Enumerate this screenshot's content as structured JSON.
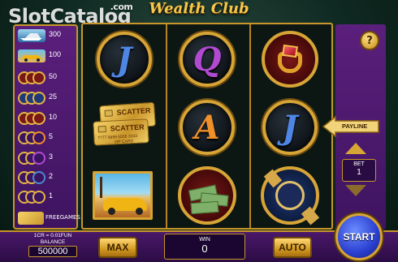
{
  "watermark": {
    "brand": "SlotCatalog",
    "suffix": ".com"
  },
  "title": "Wealth Club",
  "paytable": [
    {
      "icon": "yacht-icon",
      "value": "300"
    },
    {
      "icon": "sports-car-icon",
      "value": "100"
    },
    {
      "icon": "money-coin-icon",
      "value": "50"
    },
    {
      "icon": "watch-coin-icon",
      "value": "25"
    },
    {
      "icon": "ring-coin-icon",
      "value": "10"
    },
    {
      "icon": "a-coin-icon",
      "value": "5"
    },
    {
      "icon": "q-coin-icon",
      "value": "3"
    },
    {
      "icon": "j-coin-icon",
      "value": "2"
    },
    {
      "icon": "coin-icon",
      "value": "1"
    }
  ],
  "freegames_label": "FREEGAMES",
  "reels": {
    "r1c1": "J",
    "r1c2": "Q",
    "r2c3": "A",
    "r2c4": "J",
    "card_scatter": "SCATTER",
    "card_number": "7777 9999 5555 3333",
    "card_vip": "VIP CARD"
  },
  "controls": {
    "help": "?",
    "payline": "PAYLINE",
    "bet_label": "BET",
    "bet_value": "1",
    "rate": "1CR = 0.01FUN",
    "balance_label": "BALANCE",
    "balance_value": "500000",
    "max": "MAX",
    "win_label": "WIN",
    "win_value": "0",
    "auto": "AUTO",
    "start": "START"
  },
  "colors": {
    "gold": "#d7a436",
    "purple": "#4a186a",
    "start_blue": "#2a3fd0"
  }
}
